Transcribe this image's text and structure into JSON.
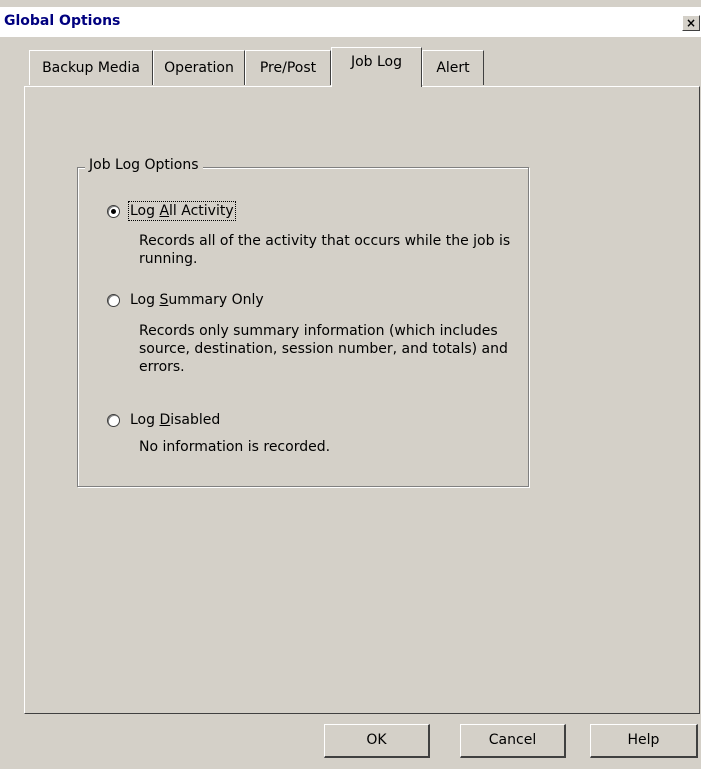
{
  "window": {
    "title": "Global Options",
    "close_glyph": "×"
  },
  "tabs": [
    {
      "label": "Backup Media",
      "active": false
    },
    {
      "label": "Operation",
      "active": false
    },
    {
      "label": "Pre/Post",
      "active": false
    },
    {
      "label": "Job Log",
      "active": true
    },
    {
      "label": "Alert",
      "active": false
    }
  ],
  "groupbox": {
    "label": "Job Log Options"
  },
  "options": [
    {
      "label_pre": "Log ",
      "label_mnemonic": "A",
      "label_post": "ll Activity",
      "description": "Records all of the activity that occurs while the job is running.",
      "checked": true
    },
    {
      "label_pre": "Log ",
      "label_mnemonic": "S",
      "label_post": "ummary Only",
      "description": "Records only summary information (which includes source, destination, session number, and totals) and errors.",
      "checked": false
    },
    {
      "label_pre": "Log ",
      "label_mnemonic": "D",
      "label_post": "isabled",
      "description": "No information is recorded.",
      "checked": false
    }
  ],
  "buttons": {
    "ok": "OK",
    "cancel": "Cancel",
    "help": "Help"
  }
}
